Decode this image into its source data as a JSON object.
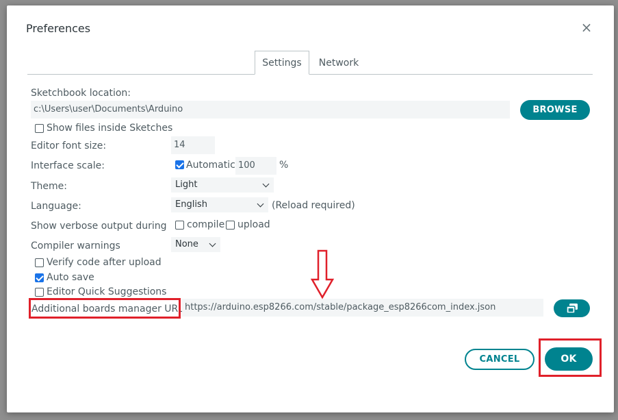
{
  "dialog": {
    "title": "Preferences",
    "close_glyph": "×"
  },
  "tabs": [
    {
      "label": "Settings",
      "active": true
    },
    {
      "label": "Network",
      "active": false
    }
  ],
  "sketchbook": {
    "label": "Sketchbook location:",
    "value": "c:\\Users\\user\\Documents\\Arduino",
    "browse_label": "BROWSE",
    "show_files_label": "Show files inside Sketches",
    "show_files_checked": false
  },
  "editor_font": {
    "label": "Editor font size:",
    "value": "14"
  },
  "interface_scale": {
    "label": "Interface scale:",
    "automatic_label": "Automatic",
    "automatic_checked": true,
    "value": "100",
    "unit": "%"
  },
  "theme": {
    "label": "Theme:",
    "selected": "Light"
  },
  "language": {
    "label": "Language:",
    "selected": "English",
    "note": "(Reload required)"
  },
  "verbose": {
    "label": "Show verbose output during",
    "compile_label": "compile",
    "compile_checked": false,
    "upload_label": "upload",
    "upload_checked": false
  },
  "compiler_warnings": {
    "label": "Compiler warnings",
    "selected": "None"
  },
  "verify_code": {
    "label": "Verify code after upload",
    "checked": false
  },
  "auto_save": {
    "label": "Auto save",
    "checked": true
  },
  "quick_suggestions": {
    "label": "Editor Quick Suggestions",
    "checked": false
  },
  "boards_urls": {
    "label": "Additional boards manager URLs:",
    "value": "https://arduino.esp8266.com/stable/package_esp8266com_index.json",
    "edit_icon": "window-restore-icon"
  },
  "footer": {
    "cancel_label": "CANCEL",
    "ok_label": "OK"
  },
  "colors": {
    "accent": "#00838f",
    "annotation": "#e0202a",
    "checkbox_checked": "#1a73e8"
  }
}
